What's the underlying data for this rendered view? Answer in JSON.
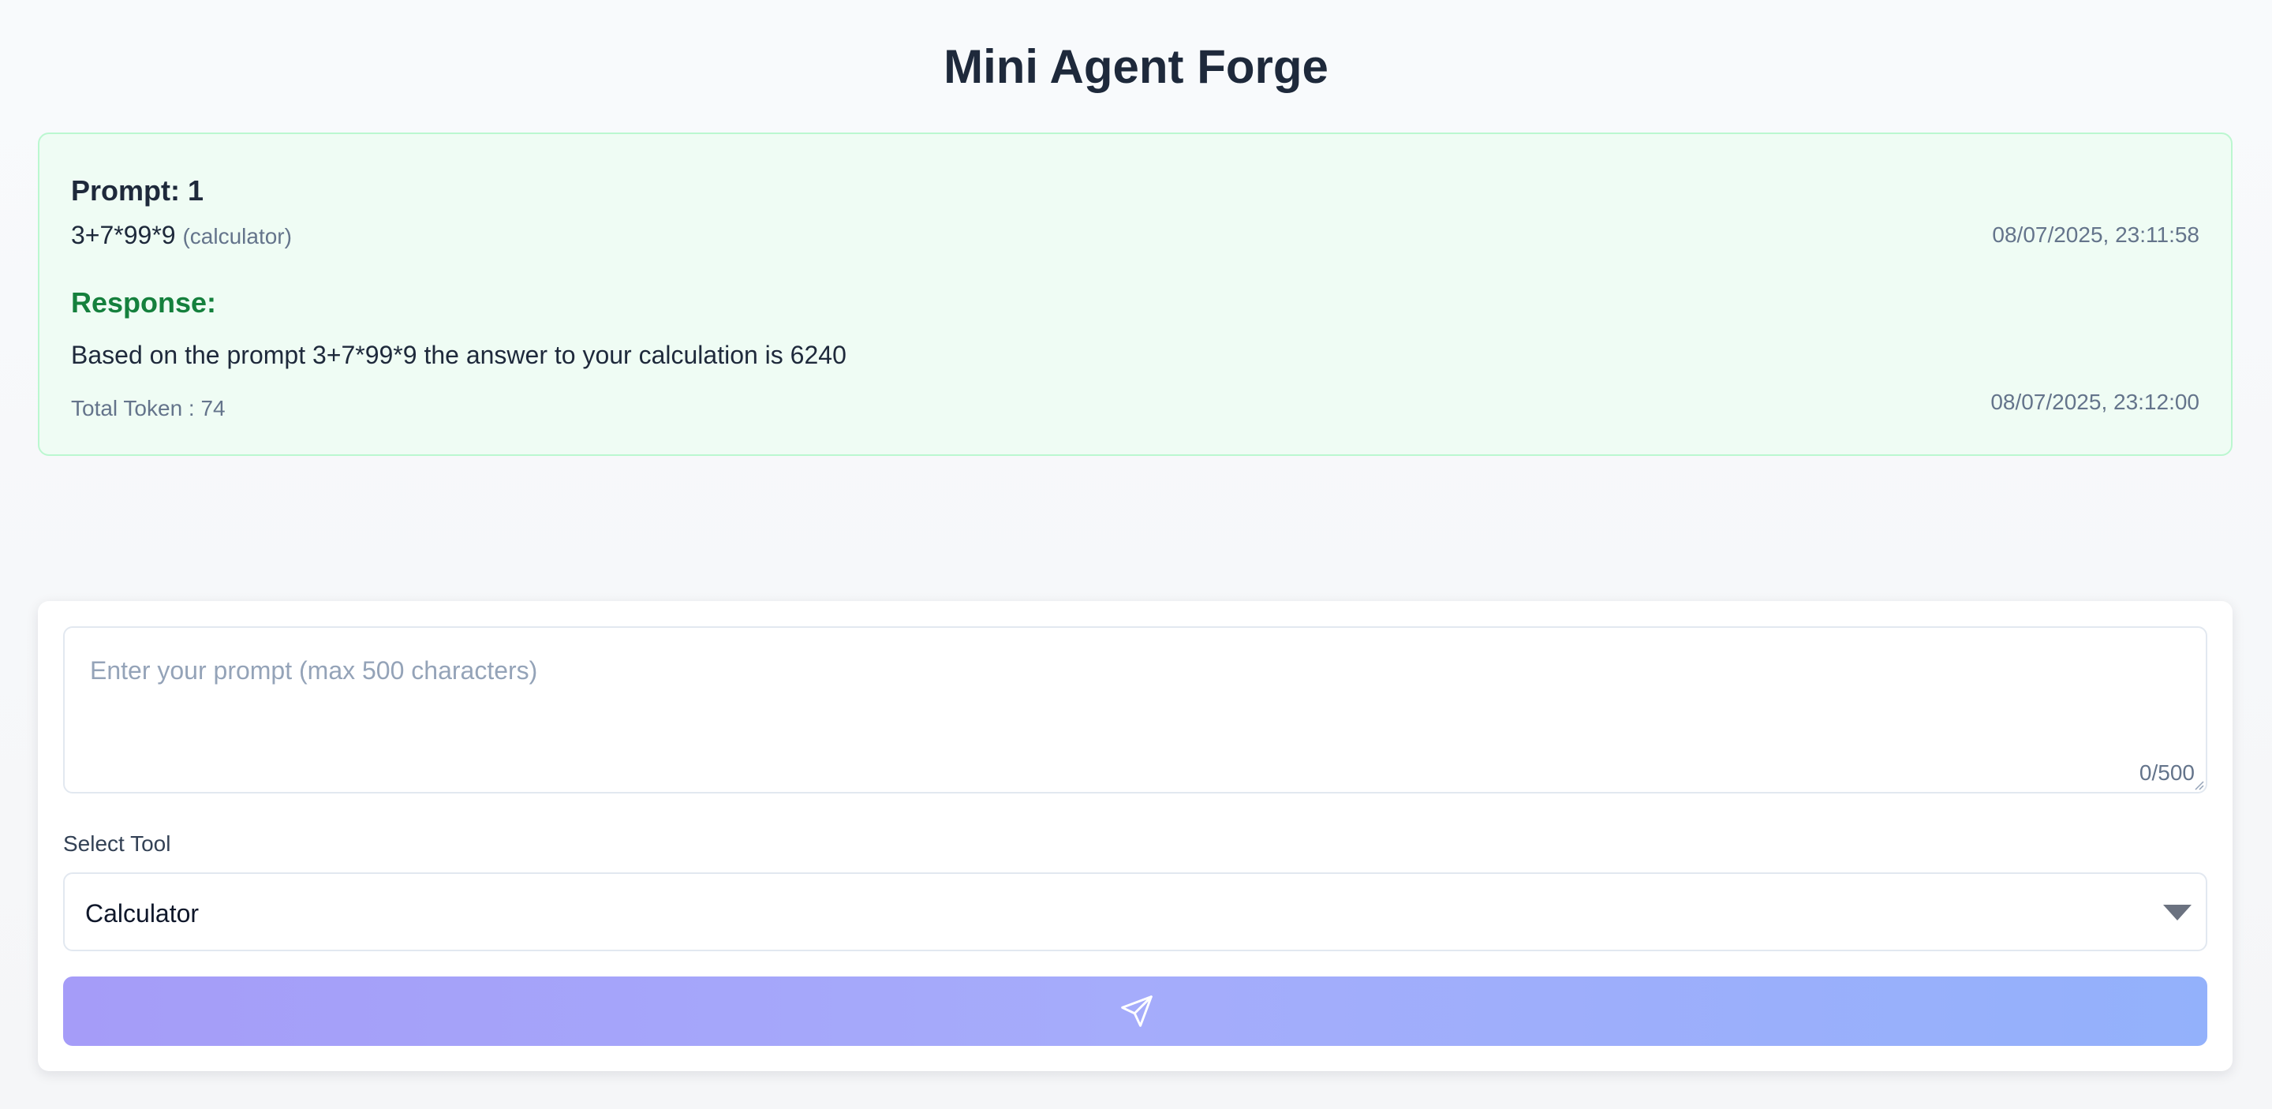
{
  "app": {
    "title": "Mini Agent Forge"
  },
  "conversation": [
    {
      "prompt_heading": "Prompt: 1",
      "prompt_text": "3+7*99*9",
      "tool_tag": "(calculator)",
      "prompt_timestamp": "08/07/2025, 23:11:58",
      "response_heading": "Response:",
      "response_text": "Based on the prompt 3+7*99*9 the answer to your calculation is 6240",
      "token_summary": "Total Token : 74",
      "response_timestamp": "08/07/2025, 23:12:00"
    }
  ],
  "composer": {
    "prompt_placeholder": "Enter your prompt (max 500 characters)",
    "prompt_value": "",
    "char_counter": "0/500",
    "tool_label": "Select Tool",
    "selected_tool": "Calculator",
    "send_icon": "paper-plane-icon",
    "chevron_icon": "chevron-down-icon"
  },
  "colors": {
    "title": "#1e293b",
    "card_background": "#effcf4",
    "card_border": "#bbf7d0",
    "response_heading": "#15803d",
    "muted_text": "#64748b",
    "send_gradient_start": "#a59cf8",
    "send_gradient_end": "#93b1fb"
  }
}
